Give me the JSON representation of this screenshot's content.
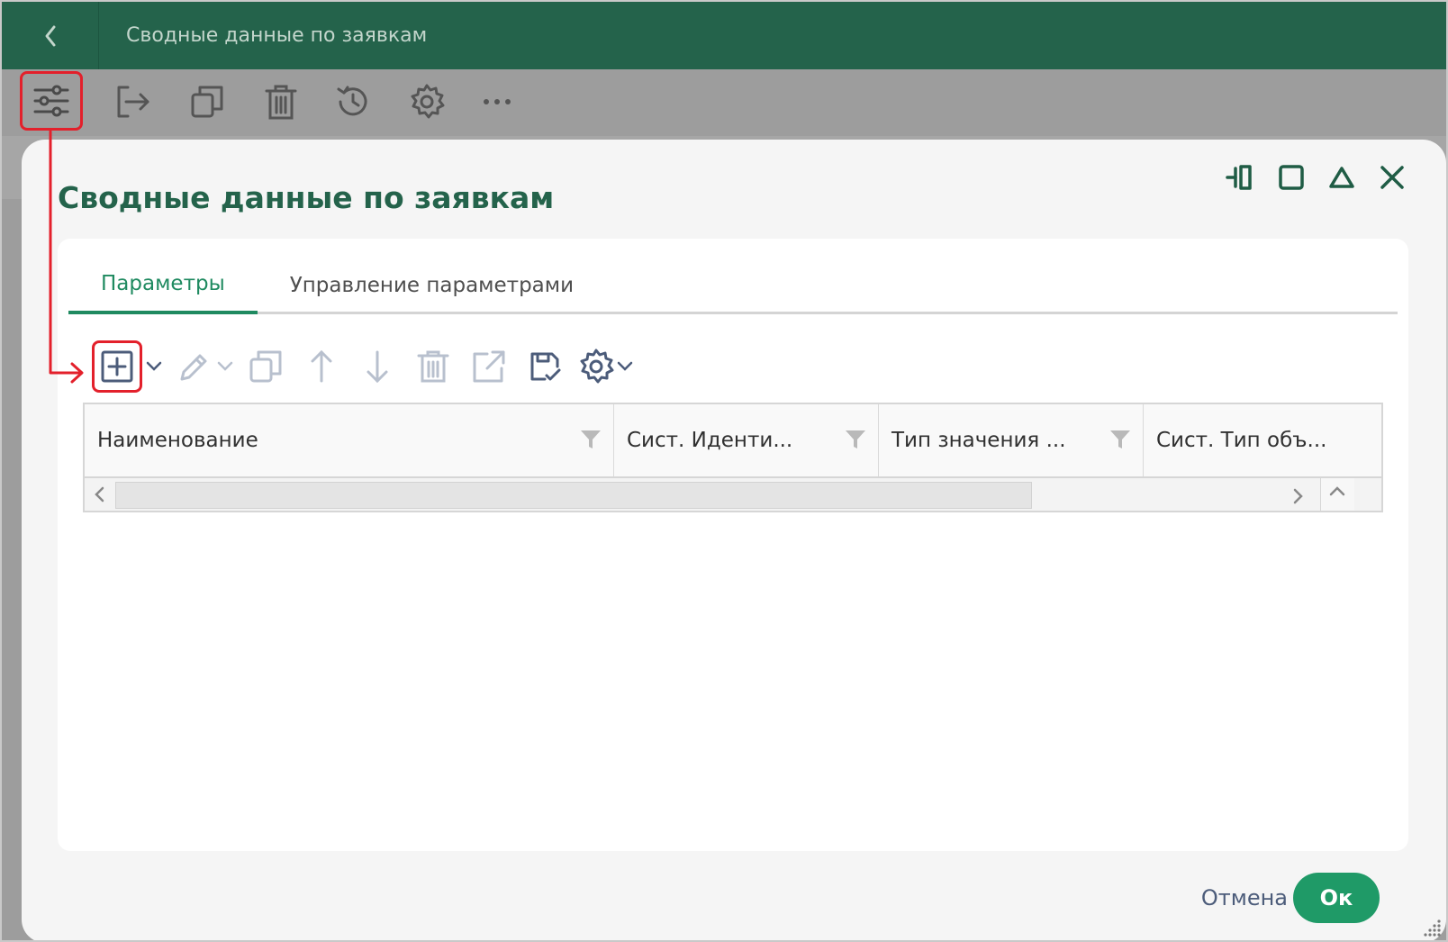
{
  "app": {
    "title": "Сводные данные по заявкам"
  },
  "app_toolbar": {
    "icons": [
      "filter-settings-icon",
      "exit-icon",
      "copy-icon",
      "trash-icon",
      "history-icon",
      "gear-icon",
      "more-icon"
    ]
  },
  "dialog": {
    "title": "Сводные данные по заявкам",
    "tabs": [
      {
        "label": "Параметры",
        "active": true
      },
      {
        "label": "Управление параметрами",
        "active": false
      }
    ],
    "columns": [
      {
        "label": "Наименование"
      },
      {
        "label": "Сист. Иденти..."
      },
      {
        "label": "Тип значения ..."
      },
      {
        "label": "Сист. Тип объ..."
      }
    ],
    "footer": {
      "cancel_label": "Отмена",
      "ok_label": "Ок"
    }
  },
  "colors": {
    "brand_green": "#24634b",
    "accent_green": "#1f9a67",
    "annotation_red": "#e3202b"
  }
}
